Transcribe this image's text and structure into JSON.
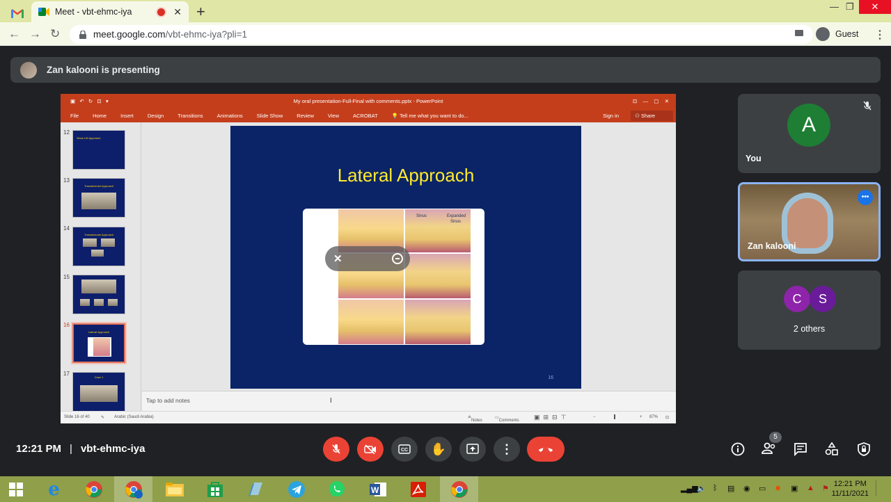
{
  "browser": {
    "tab_title": "Meet - vbt-ehmc-iya",
    "url_host": "meet.google.com",
    "url_path": "/vbt-ehmc-iya?pli=1",
    "profile_label": "Guest"
  },
  "meet": {
    "presenting_banner": "Zan kalooni is presenting",
    "time": "12:21 PM",
    "meeting_code": "vbt-ehmc-iya",
    "participant_count": "5",
    "tiles": {
      "you": {
        "initial": "A",
        "name": "You"
      },
      "presenter": {
        "name": "Zan kalooni"
      },
      "others": {
        "initial_1": "C",
        "initial_2": "S",
        "label": "2 others"
      }
    }
  },
  "powerpoint": {
    "window_title": "My oral presentation-Full-Final with comments.pptx - PowerPoint",
    "menu": [
      "File",
      "Home",
      "Insert",
      "Design",
      "Transitions",
      "Animations",
      "Slide Show",
      "Review",
      "View",
      "ACROBAT"
    ],
    "tell_me": "Tell me what you want to do...",
    "sign_in": "Sign in",
    "share": "Share",
    "thumbnails": [
      {
        "num": "12",
        "title": "Sinus Lift Approach"
      },
      {
        "num": "13",
        "title": "Transalveolar Approach"
      },
      {
        "num": "14",
        "title": "Transalveolar Approach"
      },
      {
        "num": "15",
        "title": ""
      },
      {
        "num": "16",
        "title": "Lateral Approach"
      },
      {
        "num": "17",
        "title": "Case 1"
      }
    ],
    "slide": {
      "title": "Lateral Approach",
      "number": "16",
      "label_sinus": "Sinus",
      "label_expanded_1": "Expanded",
      "label_expanded_2": "Sinus"
    },
    "notes_placeholder": "Tap to add notes",
    "status": {
      "slide_of": "Slide 16 of 40",
      "language": "Arabic (Saudi Arabia)",
      "notes": "Notes",
      "comments": "Comments",
      "zoom": "87%"
    }
  },
  "taskbar": {
    "clock_time": "12:21 PM",
    "clock_date": "11/11/2021"
  },
  "colors": {
    "meet_bg": "#202124",
    "meet_red": "#ea4335",
    "ppt_orange": "#c43e1c",
    "slide_blue": "#0a2467",
    "slide_title": "#ffea2b",
    "chrome_theme": "#dfe6a6"
  }
}
